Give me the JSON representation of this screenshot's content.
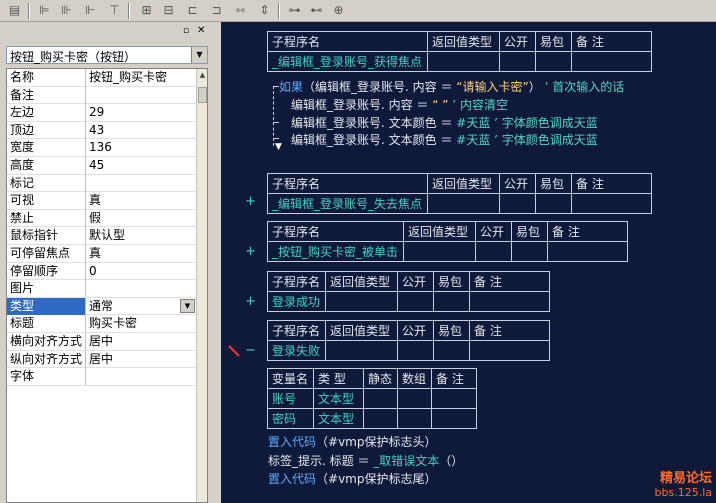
{
  "toolbar": {
    "icons": [
      "form-icon",
      "align-left-icon",
      "align-center-icon",
      "align-right-icon",
      "align-top-icon",
      "align-middle-icon",
      "align-bottom-icon",
      "same-width-icon",
      "same-height-icon",
      "same-size-icon",
      "h-space-icon",
      "v-space-icon",
      "center-h-icon",
      "center-v-icon",
      "center-both-icon"
    ]
  },
  "property_panel": {
    "selected_component": "按钮_购买卡密（按钮）",
    "rows": [
      {
        "key": "名称",
        "value": "按钮_购买卡密"
      },
      {
        "key": "备注",
        "value": ""
      },
      {
        "key": "左边",
        "value": "29"
      },
      {
        "key": "顶边",
        "value": "43"
      },
      {
        "key": "宽度",
        "value": "136"
      },
      {
        "key": "高度",
        "value": "45"
      },
      {
        "key": "标记",
        "value": ""
      },
      {
        "key": "可视",
        "value": "真"
      },
      {
        "key": "禁止",
        "value": "假"
      },
      {
        "key": "鼠标指针",
        "value": "默认型"
      },
      {
        "key": "可停留焦点",
        "value": "真"
      },
      {
        "key": "  停留顺序",
        "value": "0"
      },
      {
        "key": "图片",
        "value": ""
      },
      {
        "key": "类型",
        "value": "通常"
      },
      {
        "key": "标题",
        "value": "购买卡密"
      },
      {
        "key": "横向对齐方式",
        "value": "居中"
      },
      {
        "key": "纵向对齐方式",
        "value": "居中"
      },
      {
        "key": "字体",
        "value": ""
      }
    ]
  },
  "editor": {
    "sub_headers": {
      "name": "子程序名",
      "ret": "返回值类型",
      "public": "公开",
      "easy": "易包",
      "note": "备 注"
    },
    "var_headers": {
      "name": "变量名",
      "type": "类 型",
      "static": "静态",
      "array": "数组",
      "note": "备 注"
    },
    "subs": [
      "_编辑框_登录账号_获得焦点",
      "_编辑框_登录账号_失去焦点",
      "_按钮_购买卡密_被单击",
      "登录成功",
      "登录失败"
    ],
    "code_lines": {
      "l1_kw": "如果",
      "l1_a": "（编辑框_登录账号. 内容 ＝ ",
      "l1_str": "“请输入卡密”",
      "l1_b": "）",
      "l1_cmt": "’ 首次输入的话",
      "l2_a": "编辑框_登录账号. 内容 ＝ ",
      "l2_str": "“ ”",
      "l2_cmt": "’ 内容清空",
      "l3_a": "编辑框_登录账号. 文本颜色 ＝ ",
      "l3_const": "#天蓝",
      "l3_cmt": "’ 字体颜色调成天蓝",
      "l4_a": "编辑框_登录账号. 文本颜色 ＝ ",
      "l4_const": "#天蓝",
      "l4_cmt": "’ 字体颜色调成天蓝"
    },
    "vars": [
      {
        "name": "账号",
        "type": "文本型"
      },
      {
        "name": "密码",
        "type": "文本型"
      }
    ],
    "tail_lines": {
      "t1_kw": "置入代码",
      "t1_rest": "（#vmp保护标志头）",
      "t2_a": "标签_提示. 标题 ＝ ",
      "t2_fn": "_取错误文本",
      "t2_b": "（）",
      "t3_kw": "置入代码",
      "t3_rest": "（#vmp保护标志尾）"
    },
    "watermark": {
      "line1": "精易论坛",
      "line2": "bbs.125.la"
    },
    "marks": {
      "plus": "+",
      "minus": "−"
    }
  }
}
